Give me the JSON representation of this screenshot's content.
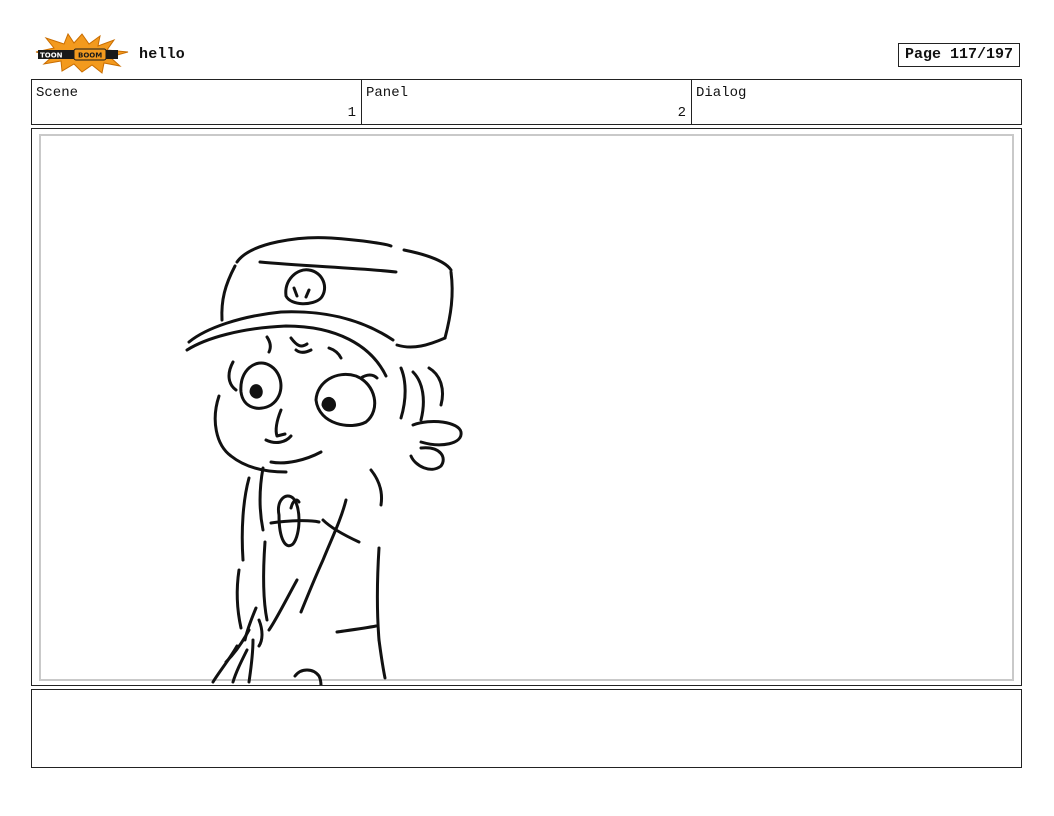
{
  "header": {
    "logo_text": "TOON BOOM",
    "project_title": "hello",
    "page_label": "Page 117/197"
  },
  "info": {
    "scene_label": "Scene",
    "scene_value": "1",
    "panel_label": "Panel",
    "panel_value": "2",
    "dialog_label": "Dialog",
    "dialog_value": ""
  },
  "notes": {
    "text": ""
  },
  "colors": {
    "logo_burst": "#f39a1e",
    "logo_band": "#1a1a1a",
    "border": "#222222",
    "safe_frame": "#c9c9c9"
  }
}
